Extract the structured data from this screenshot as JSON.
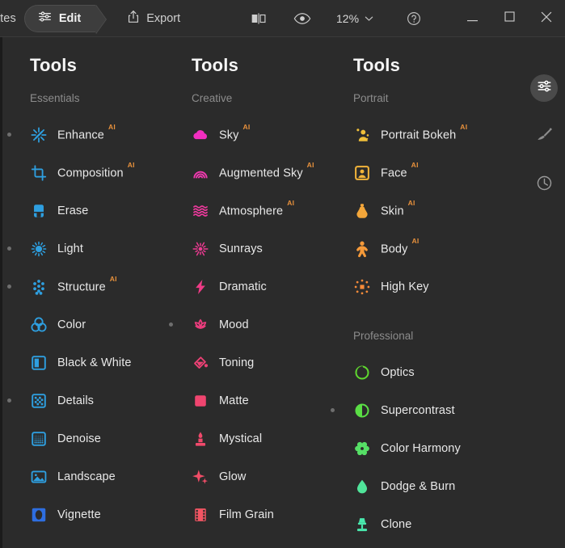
{
  "toolbar": {
    "breadcrumb_prev": "ates",
    "edit_label": "Edit",
    "edit_icon": "sliders-icon",
    "export_label": "Export",
    "export_icon": "share-upload-icon",
    "compare_icon": "compare-split-icon",
    "preview_icon": "eye-icon",
    "zoom_value": "12%",
    "zoom_chevron_icon": "chevron-down-icon",
    "help_icon": "help-circle-icon",
    "minimize_icon": "minimize-icon",
    "maximize_icon": "maximize-icon",
    "close_icon": "close-icon"
  },
  "right_rail": {
    "items": [
      {
        "name": "adjust-sliders",
        "icon": "sliders-icon",
        "active": true
      },
      {
        "name": "brush",
        "icon": "brush-icon",
        "active": false
      },
      {
        "name": "history",
        "icon": "clock-history-icon",
        "active": false
      }
    ]
  },
  "columns": [
    {
      "title": "Tools",
      "accent": "#2e9fe0",
      "groups": [
        {
          "label": "Essentials",
          "tools": [
            {
              "label": "Enhance",
              "ai": "AI",
              "dot": true,
              "icon": "enhance-starburst-icon",
              "color": "#2e9fe0"
            },
            {
              "label": "Composition",
              "ai": "AI",
              "dot": false,
              "icon": "crop-icon",
              "color": "#2e9fe0"
            },
            {
              "label": "Erase",
              "ai": "",
              "dot": false,
              "icon": "eraser-icon",
              "color": "#2e9fe0"
            },
            {
              "label": "Light",
              "ai": "",
              "dot": true,
              "icon": "sun-icon",
              "color": "#2e9fe0"
            },
            {
              "label": "Structure",
              "ai": "AI",
              "dot": true,
              "icon": "structure-dots-icon",
              "color": "#2e9fe0"
            },
            {
              "label": "Color",
              "ai": "",
              "dot": false,
              "icon": "color-circles-icon",
              "color": "#2e9fe0"
            },
            {
              "label": "Black & White",
              "ai": "",
              "dot": false,
              "icon": "black-white-icon",
              "color": "#2e9fe0"
            },
            {
              "label": "Details",
              "ai": "",
              "dot": true,
              "icon": "details-grid-icon",
              "color": "#2e9fe0"
            },
            {
              "label": "Denoise",
              "ai": "",
              "dot": false,
              "icon": "denoise-icon",
              "color": "#2e9fe0"
            },
            {
              "label": "Landscape",
              "ai": "",
              "dot": false,
              "icon": "landscape-photo-icon",
              "color": "#2e9fe0"
            },
            {
              "label": "Vignette",
              "ai": "",
              "dot": false,
              "icon": "vignette-icon",
              "color": "#2e6ee0"
            }
          ]
        }
      ]
    },
    {
      "title": "Tools",
      "accent": "#ef4a8c",
      "groups": [
        {
          "label": "Creative",
          "tools": [
            {
              "label": "Sky",
              "ai": "AI",
              "dot": false,
              "icon": "cloud-icon",
              "color": "#f22ec0"
            },
            {
              "label": "Augmented Sky",
              "ai": "AI",
              "dot": false,
              "icon": "rainbow-icon",
              "color": "#f03ab0"
            },
            {
              "label": "Atmosphere",
              "ai": "AI",
              "dot": false,
              "icon": "waves-icon",
              "color": "#ef3a9e"
            },
            {
              "label": "Sunrays",
              "ai": "",
              "dot": false,
              "icon": "sunrays-icon",
              "color": "#ee3a92"
            },
            {
              "label": "Dramatic",
              "ai": "",
              "dot": false,
              "icon": "bolt-icon",
              "color": "#ee3b86"
            },
            {
              "label": "Mood",
              "ai": "",
              "dot": true,
              "icon": "lotus-icon",
              "color": "#ed3d7e"
            },
            {
              "label": "Toning",
              "ai": "",
              "dot": false,
              "icon": "paint-pour-icon",
              "color": "#ed4175"
            },
            {
              "label": "Matte",
              "ai": "",
              "dot": false,
              "icon": "square-fill-icon",
              "color": "#ef456f"
            },
            {
              "label": "Mystical",
              "ai": "",
              "dot": false,
              "icon": "candle-icon",
              "color": "#f0496b"
            },
            {
              "label": "Glow",
              "ai": "",
              "dot": false,
              "icon": "sparkle-icon",
              "color": "#f14d67"
            },
            {
              "label": "Film Grain",
              "ai": "",
              "dot": false,
              "icon": "film-strip-icon",
              "color": "#f25563"
            }
          ]
        }
      ]
    },
    {
      "title": "Tools",
      "accent": "#f0a33a",
      "groups": [
        {
          "label": "Portrait",
          "tools": [
            {
              "label": "Portrait Bokeh",
              "ai": "AI",
              "dot": false,
              "icon": "person-bokeh-icon",
              "color": "#f0c03a"
            },
            {
              "label": "Face",
              "ai": "AI",
              "dot": false,
              "icon": "face-frame-icon",
              "color": "#f2b43a"
            },
            {
              "label": "Skin",
              "ai": "AI",
              "dot": false,
              "icon": "skin-bottle-icon",
              "color": "#f3a63a"
            },
            {
              "label": "Body",
              "ai": "AI",
              "dot": false,
              "icon": "body-person-icon",
              "color": "#f59a3a"
            },
            {
              "label": "High Key",
              "ai": "",
              "dot": false,
              "icon": "high-key-icon",
              "color": "#f68b3a"
            }
          ]
        },
        {
          "label": "Professional",
          "tools": [
            {
              "label": "Optics",
              "ai": "",
              "dot": false,
              "icon": "optics-lens-icon",
              "color": "#5fd82e"
            },
            {
              "label": "Supercontrast",
              "ai": "",
              "dot": true,
              "icon": "contrast-half-icon",
              "color": "#5ade45"
            },
            {
              "label": "Color Harmony",
              "ai": "",
              "dot": false,
              "icon": "flower-gear-icon",
              "color": "#56e066"
            },
            {
              "label": "Dodge & Burn",
              "ai": "",
              "dot": false,
              "icon": "droplet-icon",
              "color": "#50e49a"
            },
            {
              "label": "Clone",
              "ai": "",
              "dot": false,
              "icon": "clone-stamp-icon",
              "color": "#49e8ad"
            }
          ]
        }
      ]
    }
  ]
}
